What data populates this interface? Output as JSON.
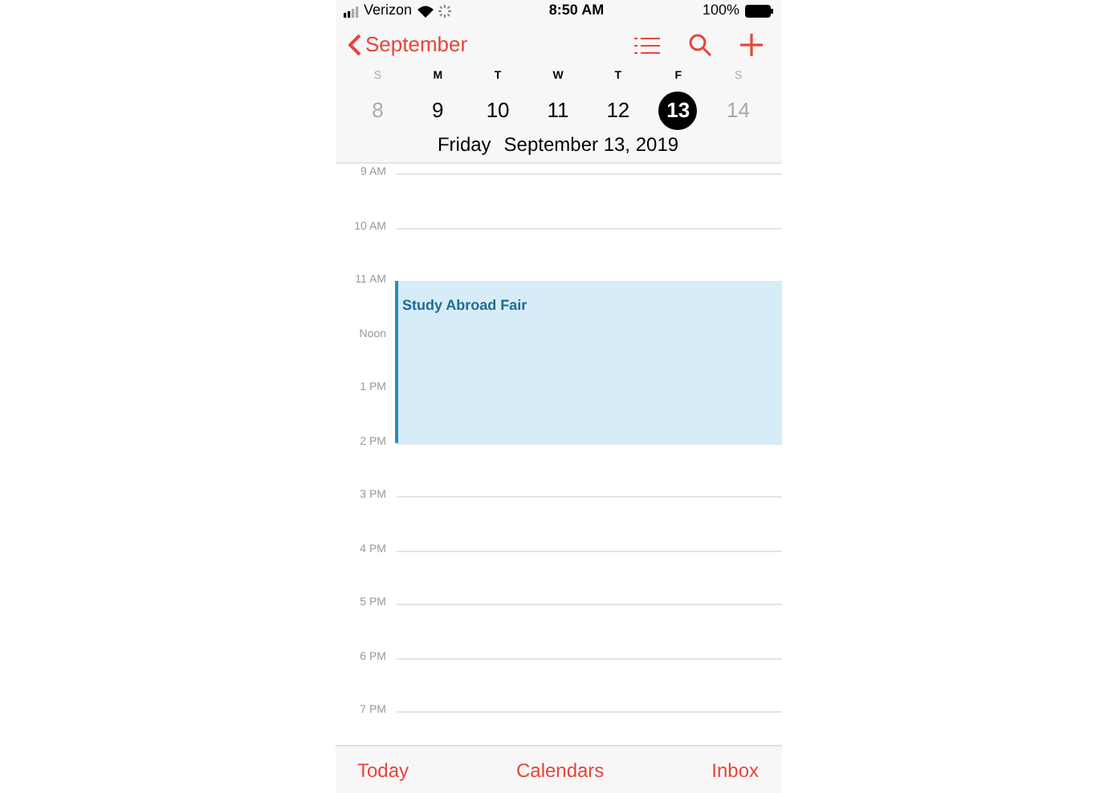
{
  "status_bar": {
    "carrier": "Verizon",
    "time": "8:50 AM",
    "battery": "100%"
  },
  "nav": {
    "back_label": "September"
  },
  "week": [
    {
      "letter": "S",
      "number": "8",
      "selected": false,
      "dimmed": true
    },
    {
      "letter": "M",
      "number": "9",
      "selected": false,
      "dimmed": false
    },
    {
      "letter": "T",
      "number": "10",
      "selected": false,
      "dimmed": false
    },
    {
      "letter": "W",
      "number": "11",
      "selected": false,
      "dimmed": false
    },
    {
      "letter": "T",
      "number": "12",
      "selected": false,
      "dimmed": false
    },
    {
      "letter": "F",
      "number": "13",
      "selected": true,
      "dimmed": false
    },
    {
      "letter": "S",
      "number": "14",
      "selected": false,
      "dimmed": true
    }
  ],
  "date_line": {
    "weekday": "Friday",
    "date": "September 13, 2019"
  },
  "hours": [
    "9 AM",
    "10 AM",
    "11 AM",
    "Noon",
    "1 PM",
    "2 PM",
    "3 PM",
    "4 PM",
    "5 PM",
    "6 PM",
    "7 PM"
  ],
  "events": [
    {
      "title": "Study Abroad Fair"
    }
  ],
  "tab_bar": [
    "Today",
    "Calendars",
    "Inbox"
  ]
}
